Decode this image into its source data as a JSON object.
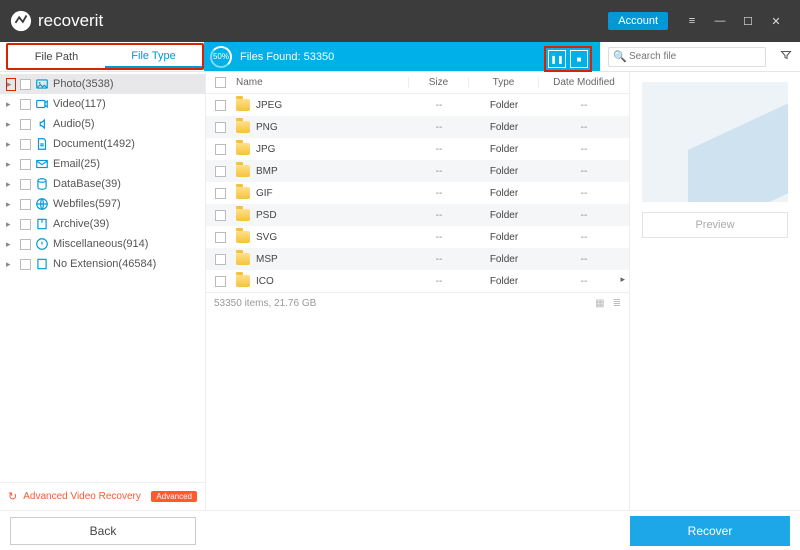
{
  "titlebar": {
    "app_name": "recoverit",
    "account_label": "Account"
  },
  "tabs": {
    "path": "File Path",
    "type": "File Type"
  },
  "scan": {
    "percent": "50%",
    "found_label": "Files Found:",
    "found_count": "53350"
  },
  "search": {
    "placeholder": "Search file"
  },
  "sidebar": {
    "items": [
      {
        "label": "Photo(3538)",
        "icon": "image"
      },
      {
        "label": "Video(117)",
        "icon": "video"
      },
      {
        "label": "Audio(5)",
        "icon": "audio"
      },
      {
        "label": "Document(1492)",
        "icon": "doc"
      },
      {
        "label": "Email(25)",
        "icon": "mail"
      },
      {
        "label": "DataBase(39)",
        "icon": "db"
      },
      {
        "label": "Webfiles(597)",
        "icon": "web"
      },
      {
        "label": "Archive(39)",
        "icon": "zip"
      },
      {
        "label": "Miscellaneous(914)",
        "icon": "misc"
      },
      {
        "label": "No Extension(46584)",
        "icon": "none"
      }
    ],
    "adv_label": "Advanced Video Recovery",
    "adv_badge": "Advanced"
  },
  "table": {
    "headers": {
      "name": "Name",
      "size": "Size",
      "type": "Type",
      "date": "Date Modified"
    },
    "rows": [
      {
        "name": "JPEG",
        "size": "--",
        "type": "Folder",
        "date": "--"
      },
      {
        "name": "PNG",
        "size": "--",
        "type": "Folder",
        "date": "--"
      },
      {
        "name": "JPG",
        "size": "--",
        "type": "Folder",
        "date": "--"
      },
      {
        "name": "BMP",
        "size": "--",
        "type": "Folder",
        "date": "--"
      },
      {
        "name": "GIF",
        "size": "--",
        "type": "Folder",
        "date": "--"
      },
      {
        "name": "PSD",
        "size": "--",
        "type": "Folder",
        "date": "--"
      },
      {
        "name": "SVG",
        "size": "--",
        "type": "Folder",
        "date": "--"
      },
      {
        "name": "MSP",
        "size": "--",
        "type": "Folder",
        "date": "--"
      },
      {
        "name": "ICO",
        "size": "--",
        "type": "Folder",
        "date": "--"
      }
    ]
  },
  "status": {
    "text": "53350 items, 21.76 GB"
  },
  "preview": {
    "button": "Preview"
  },
  "footer": {
    "back": "Back",
    "recover": "Recover"
  }
}
